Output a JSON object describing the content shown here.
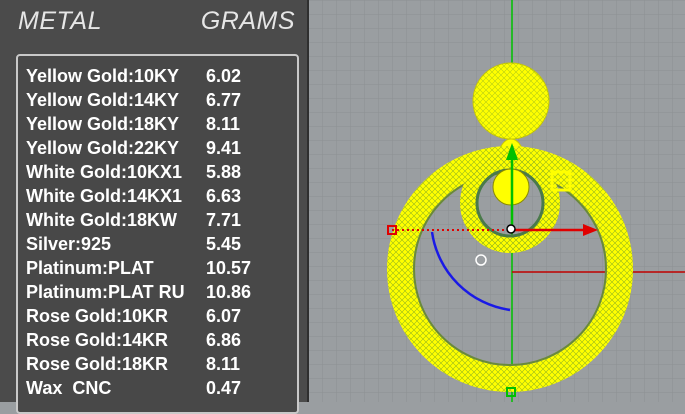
{
  "panel": {
    "header_metal": "METAL",
    "header_grams": "GRAMS",
    "rows": [
      {
        "name": "Yellow Gold:10KY",
        "grams": "6.02"
      },
      {
        "name": "Yellow Gold:14KY",
        "grams": "6.77"
      },
      {
        "name": "Yellow Gold:18KY",
        "grams": "8.11"
      },
      {
        "name": "Yellow Gold:22KY",
        "grams": "9.41"
      },
      {
        "name": "White Gold:10KX1",
        "grams": "5.88"
      },
      {
        "name": "White Gold:14KX1",
        "grams": "6.63"
      },
      {
        "name": "White Gold:18KW",
        "grams": "7.71"
      },
      {
        "name": "Silver:925",
        "grams": "5.45"
      },
      {
        "name": "Platinum:PLAT",
        "grams": "10.57"
      },
      {
        "name": "Platinum:PLAT RU",
        "grams": "10.86"
      },
      {
        "name": "Rose Gold:10KR",
        "grams": "6.07"
      },
      {
        "name": "Rose Gold:14KR",
        "grams": "6.86"
      },
      {
        "name": "Rose Gold:18KR",
        "grams": "8.11"
      },
      {
        "name": "Wax  CNC",
        "grams": "0.47"
      }
    ]
  },
  "colors": {
    "viewport_bg": "#9a9ea1",
    "grid_line": "#8a8e91",
    "model": "#ffff00",
    "model_shadow": "#4a7a4a",
    "y_axis": "#00c000",
    "x_axis": "#c00000",
    "gizmo_x": "#e00000",
    "gizmo_y": "#00c000",
    "arc": "#1a1ae6",
    "panel_bg": "#4b4b4b",
    "text": "#ffffff"
  },
  "icons": [
    "move-gizmo-icon",
    "pivot-point-icon",
    "cursor-circle-icon"
  ]
}
